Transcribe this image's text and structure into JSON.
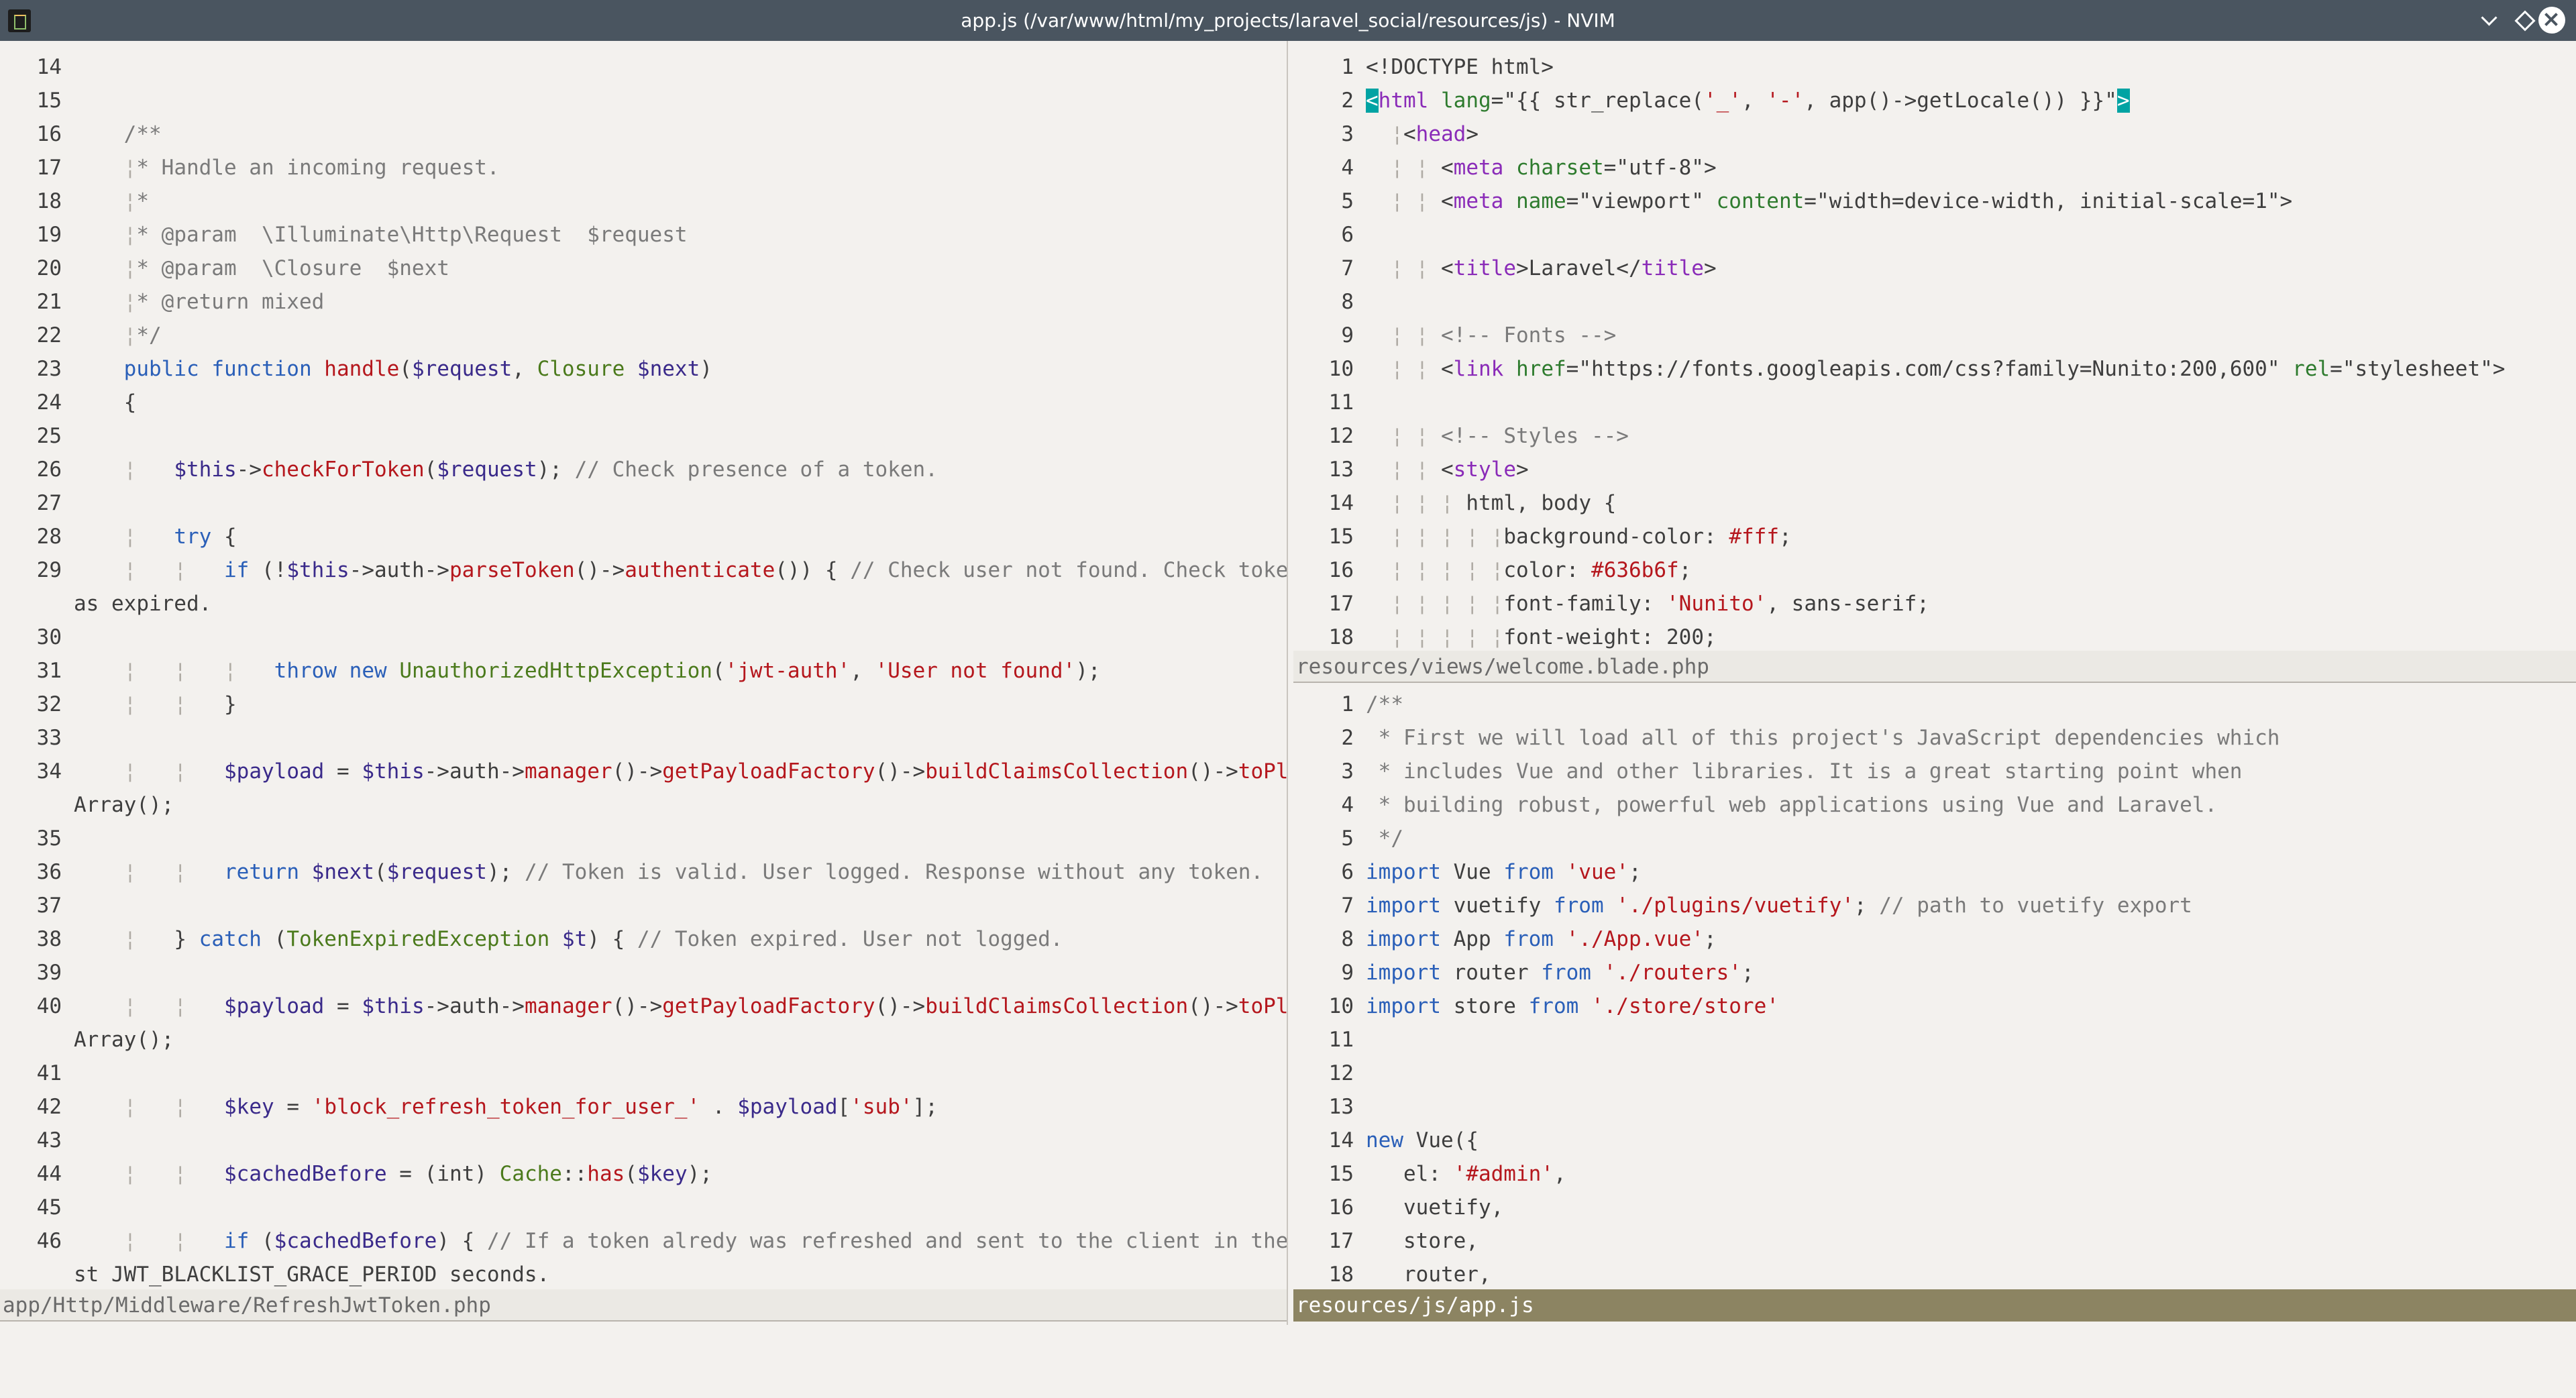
{
  "window": {
    "title": "app.js (/var/www/html/my_projects/laravel_social/resources/js) - NVIM"
  },
  "left_pane": {
    "filename": "app/Http/Middleware/RefreshJwtToken.php",
    "lines": [
      {
        "n": "14",
        "code": ""
      },
      {
        "n": "15",
        "code": ""
      },
      {
        "n": "16",
        "code": "    /**"
      },
      {
        "n": "17",
        "code": "    ¦* Handle an incoming request."
      },
      {
        "n": "18",
        "code": "    ¦*"
      },
      {
        "n": "19",
        "code": "    ¦* @param  \\Illuminate\\Http\\Request  $request"
      },
      {
        "n": "20",
        "code": "    ¦* @param  \\Closure  $next"
      },
      {
        "n": "21",
        "code": "    ¦* @return mixed"
      },
      {
        "n": "22",
        "code": "    ¦*/"
      },
      {
        "n": "23",
        "code": "    public function handle($request, Closure $next)"
      },
      {
        "n": "24",
        "code": "    {"
      },
      {
        "n": "25",
        "code": ""
      },
      {
        "n": "26",
        "code": "    ¦   $this->checkForToken($request); // Check presence of a token."
      },
      {
        "n": "27",
        "code": ""
      },
      {
        "n": "28",
        "code": "    ¦   try {"
      },
      {
        "n": "29",
        "code": "    ¦   ¦   if (!$this->auth->parseToken()->authenticate()) { // Check user not found. Check token h",
        "wrap": "as expired."
      },
      {
        "n": "30",
        "code": ""
      },
      {
        "n": "31",
        "code": "    ¦   ¦   ¦   throw new UnauthorizedHttpException('jwt-auth', 'User not found');"
      },
      {
        "n": "32",
        "code": "    ¦   ¦   }"
      },
      {
        "n": "33",
        "code": ""
      },
      {
        "n": "34",
        "code": "    ¦   ¦   $payload = $this->auth->manager()->getPayloadFactory()->buildClaimsCollection()->toPlain",
        "wrap": "Array();"
      },
      {
        "n": "35",
        "code": ""
      },
      {
        "n": "36",
        "code": "    ¦   ¦   return $next($request); // Token is valid. User logged. Response without any token."
      },
      {
        "n": "37",
        "code": ""
      },
      {
        "n": "38",
        "code": "    ¦   } catch (TokenExpiredException $t) { // Token expired. User not logged."
      },
      {
        "n": "39",
        "code": ""
      },
      {
        "n": "40",
        "code": "    ¦   ¦   $payload = $this->auth->manager()->getPayloadFactory()->buildClaimsCollection()->toPlain",
        "wrap": "Array();"
      },
      {
        "n": "41",
        "code": ""
      },
      {
        "n": "42",
        "code": "    ¦   ¦   $key = 'block_refresh_token_for_user_' . $payload['sub'];"
      },
      {
        "n": "43",
        "code": ""
      },
      {
        "n": "44",
        "code": "    ¦   ¦   $cachedBefore = (int) Cache::has($key);"
      },
      {
        "n": "45",
        "code": ""
      },
      {
        "n": "46",
        "code": "    ¦   ¦   if ($cachedBefore) { // If a token alredy was refreshed and sent to the client in the la",
        "wrap": "st JWT_BLACKLIST_GRACE_PERIOD seconds."
      }
    ]
  },
  "right_top_pane": {
    "filename": "resources/views/welcome.blade.php",
    "lines": [
      {
        "n": "1",
        "code": "<!DOCTYPE html>"
      },
      {
        "n": "2",
        "code": "<html lang=\"{{ str_replace('_', '-', app()->getLocale()) }}\">"
      },
      {
        "n": "3",
        "code": "  ¦<head>"
      },
      {
        "n": "4",
        "code": "  ¦ ¦ <meta charset=\"utf-8\">"
      },
      {
        "n": "5",
        "code": "  ¦ ¦ <meta name=\"viewport\" content=\"width=device-width, initial-scale=1\">"
      },
      {
        "n": "6",
        "code": ""
      },
      {
        "n": "7",
        "code": "  ¦ ¦ <title>Laravel</title>"
      },
      {
        "n": "8",
        "code": ""
      },
      {
        "n": "9",
        "code": "  ¦ ¦ <!-- Fonts -->"
      },
      {
        "n": "10",
        "code": "  ¦ ¦ <link href=\"https://fonts.googleapis.com/css?family=Nunito:200,600\" rel=\"stylesheet\">"
      },
      {
        "n": "11",
        "code": ""
      },
      {
        "n": "12",
        "code": "  ¦ ¦ <!-- Styles -->"
      },
      {
        "n": "13",
        "code": "  ¦ ¦ <style>"
      },
      {
        "n": "14",
        "code": "  ¦ ¦ ¦ html, body {"
      },
      {
        "n": "15",
        "code": "  ¦ ¦ ¦ ¦ ¦background-color: #fff;"
      },
      {
        "n": "16",
        "code": "  ¦ ¦ ¦ ¦ ¦color: #636b6f;"
      },
      {
        "n": "17",
        "code": "  ¦ ¦ ¦ ¦ ¦font-family: 'Nunito', sans-serif;"
      },
      {
        "n": "18",
        "code": "  ¦ ¦ ¦ ¦ ¦font-weight: 200;"
      }
    ]
  },
  "right_bottom_pane": {
    "filename": "resources/js/app.js",
    "lines": [
      {
        "n": "1",
        "code": "/**"
      },
      {
        "n": "2",
        "code": " * First we will load all of this project's JavaScript dependencies which"
      },
      {
        "n": "3",
        "code": " * includes Vue and other libraries. It is a great starting point when"
      },
      {
        "n": "4",
        "code": " * building robust, powerful web applications using Vue and Laravel."
      },
      {
        "n": "5",
        "code": " */"
      },
      {
        "n": "6",
        "code": "import Vue from 'vue';"
      },
      {
        "n": "7",
        "code": "import vuetify from './plugins/vuetify'; // path to vuetify export"
      },
      {
        "n": "8",
        "code": "import App from './App.vue';"
      },
      {
        "n": "9",
        "code": "import router from './routers';"
      },
      {
        "n": "10",
        "code": "import store from './store/store'"
      },
      {
        "n": "11",
        "code": ""
      },
      {
        "n": "12",
        "code": ""
      },
      {
        "n": "13",
        "code": ""
      },
      {
        "n": "14",
        "code": "new Vue({"
      },
      {
        "n": "15",
        "code": "   el: '#admin',"
      },
      {
        "n": "16",
        "code": "   vuetify,"
      },
      {
        "n": "17",
        "code": "   store,"
      },
      {
        "n": "18",
        "code": "   router,"
      }
    ]
  }
}
